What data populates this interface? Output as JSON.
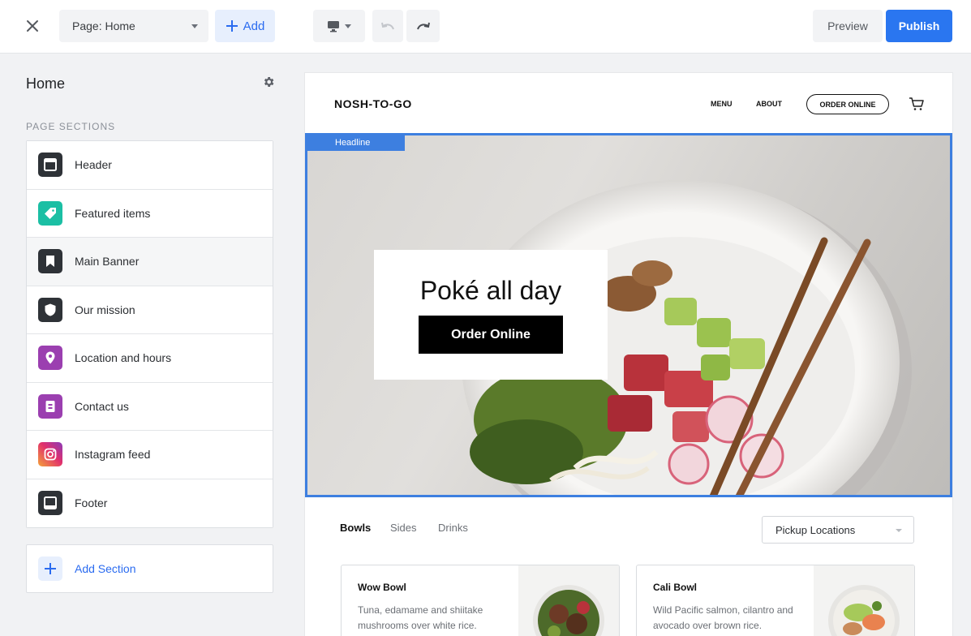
{
  "toolbar": {
    "page_select": "Page: Home",
    "add_label": "Add",
    "preview_label": "Preview",
    "publish_label": "Publish"
  },
  "sidebar": {
    "title": "Home",
    "sections_label": "PAGE SECTIONS",
    "items": [
      {
        "label": "Header",
        "icon": "header-icon",
        "color": "#2e3237"
      },
      {
        "label": "Featured items",
        "icon": "tag-icon",
        "color": "#1bbfa4"
      },
      {
        "label": "Main Banner",
        "icon": "bookmark-icon",
        "color": "#2e3237"
      },
      {
        "label": "Our mission",
        "icon": "shield-icon",
        "color": "#2e3237"
      },
      {
        "label": "Location and hours",
        "icon": "location-pin-icon",
        "color": "#9b3fb0"
      },
      {
        "label": "Contact us",
        "icon": "contact-card-icon",
        "color": "#9b3fb0"
      },
      {
        "label": "Instagram feed",
        "icon": "instagram-icon",
        "color": "#d6327c"
      },
      {
        "label": "Footer",
        "icon": "footer-icon",
        "color": "#2e3237"
      }
    ],
    "add_section_label": "Add Section"
  },
  "site": {
    "logo": "NOSH-TO-GO",
    "nav": {
      "menu": "MENU",
      "about": "ABOUT",
      "order_online": "ORDER ONLINE"
    },
    "hero": {
      "tag": "Headline",
      "title": "Poké all day",
      "button": "Order Online"
    },
    "tabs": [
      "Bowls",
      "Sides",
      "Drinks"
    ],
    "location_select": "Pickup Locations",
    "menu_items": [
      {
        "name": "Wow Bowl",
        "desc": "Tuna, edamame and shiitake mushrooms over white rice."
      },
      {
        "name": "Cali Bowl",
        "desc": "Wild Pacific salmon, cilantro and avocado over brown rice."
      }
    ]
  },
  "colors": {
    "accent": "#2a76f0",
    "selection": "#3d7fe0"
  }
}
